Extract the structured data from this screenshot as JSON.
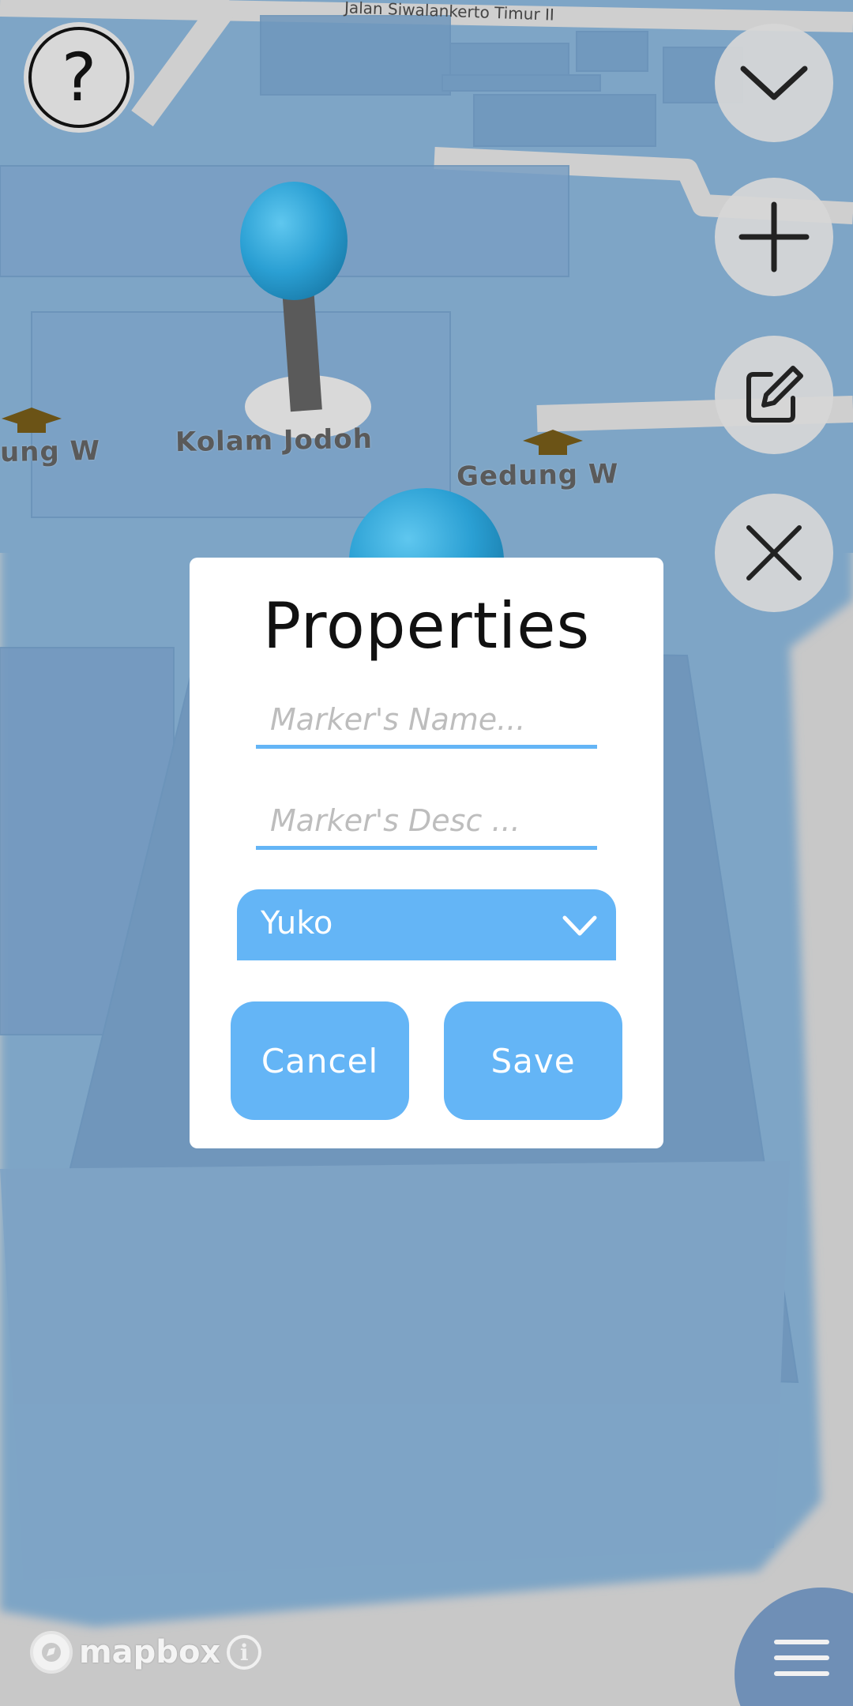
{
  "map": {
    "street_label": "Jalan Siwalankerto Timur II",
    "labels": [
      "ung W",
      "Kolam Jodoh",
      "Gedung W"
    ],
    "water_color": "#7aa2c2",
    "pin_color": "#2aa0d4"
  },
  "help_button": {
    "icon": "question-mark-icon",
    "glyph": "?"
  },
  "right_controls": [
    {
      "name": "collapse",
      "icon": "chevron-down-icon"
    },
    {
      "name": "add-marker",
      "icon": "plus-icon"
    },
    {
      "name": "edit-marker",
      "icon": "edit-icon"
    },
    {
      "name": "close",
      "icon": "close-icon"
    }
  ],
  "dialog": {
    "title": "Properties",
    "name_field": {
      "value": "",
      "placeholder": "Marker's Name..."
    },
    "desc_field": {
      "value": "",
      "placeholder": "Marker's Desc ..."
    },
    "dropdown": {
      "selected": "Yuko"
    },
    "cancel_label": "Cancel",
    "save_label": "Save",
    "accent_color": "#64b5f6"
  },
  "attribution": {
    "logo_text": "mapbox",
    "info_glyph": "i"
  },
  "menu_button": {
    "icon": "hamburger-menu-icon"
  }
}
